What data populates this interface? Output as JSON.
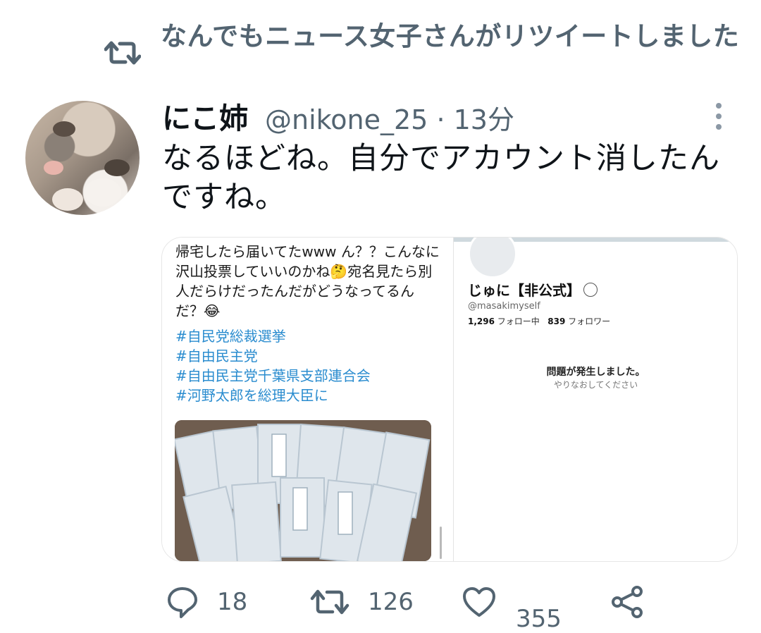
{
  "retweet_header": {
    "icon": "retweet-icon",
    "text": "なんでもニュース女子さんがリツイートしました"
  },
  "tweet": {
    "author_name": "にこ姉",
    "handle_time": "@nikone_25 · 13分",
    "text": "なるほどね。自分でアカウント消したんですね。",
    "avatar_icon": "cat-avatar"
  },
  "media_left": {
    "text": "帰宅したら届いてたwww ん？？こんなに沢山投票していいのかね🤔宛名見たら別人だらけだったんだがどうなってるんだ？😂",
    "hashtags": [
      "#自民党総裁選挙",
      "#自由民主党",
      "#自由民主党千葉県支部連合会",
      "#河野太郎を総理大臣に"
    ],
    "photo_icon": "ballot-envelopes-photo"
  },
  "media_right": {
    "name": "じゅに【非公式】",
    "handle": "@masakimyself",
    "following_count": "1,296",
    "following_label": "フォロー中",
    "followers_count": "839",
    "followers_label": "フォロワー",
    "error_title": "問題が発生しました。",
    "error_sub": "やりなおしてください"
  },
  "actions": {
    "reply_count": "18",
    "retweet_count": "126",
    "like_count": "355",
    "icons": [
      "reply-icon",
      "retweet-icon",
      "heart-icon",
      "share-icon"
    ]
  },
  "colors": {
    "secondary_text": "#536471",
    "hashtag": "#2a8ccf",
    "primary_text": "#0f1419"
  }
}
